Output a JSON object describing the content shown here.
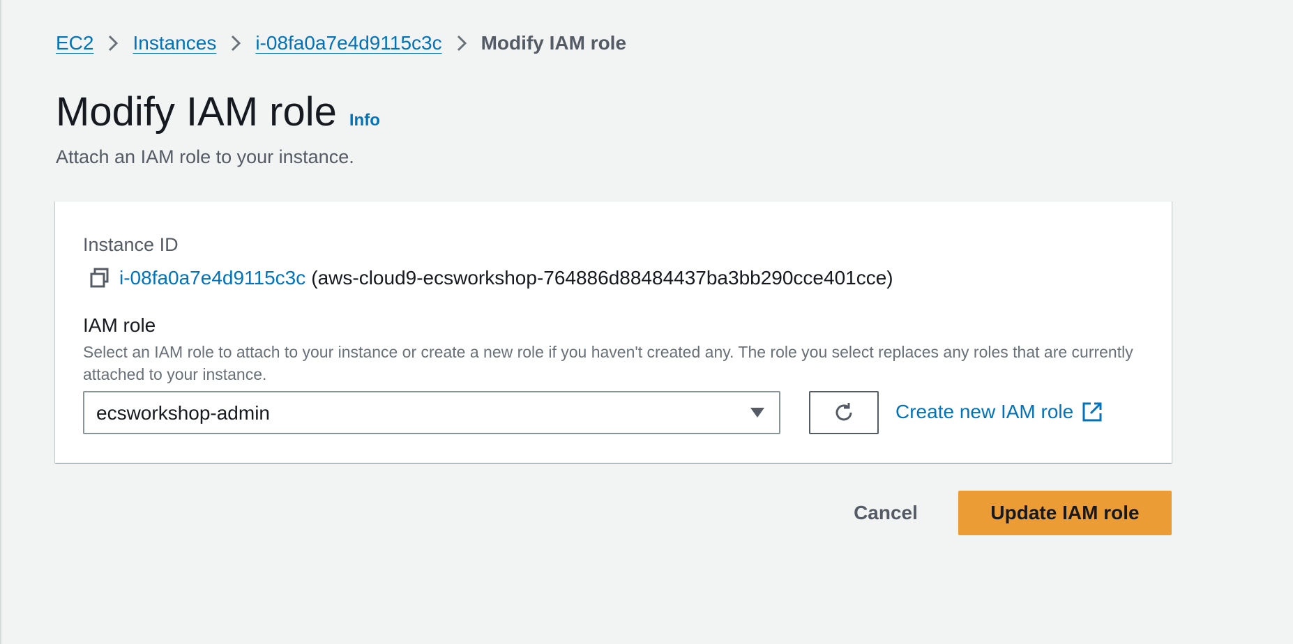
{
  "breadcrumb": {
    "items": [
      {
        "label": "EC2"
      },
      {
        "label": "Instances"
      },
      {
        "label": "i-08fa0a7e4d9115c3c"
      }
    ],
    "current": "Modify IAM role"
  },
  "header": {
    "title": "Modify IAM role",
    "info_label": "Info",
    "description": "Attach an IAM role to your instance."
  },
  "instance": {
    "label": "Instance ID",
    "id": "i-08fa0a7e4d9115c3c",
    "name": "(aws-cloud9-ecsworkshop-764886d88484437ba3bb290cce401cce)"
  },
  "iam_role": {
    "label": "IAM role",
    "description": "Select an IAM role to attach to your instance or create a new role if you haven't created any. The role you select replaces any roles that are currently attached to your instance.",
    "selected": "ecsworkshop-admin",
    "create_link": "Create new IAM role"
  },
  "actions": {
    "cancel": "Cancel",
    "submit": "Update IAM role"
  },
  "colors": {
    "background": "#f2f3f3",
    "link": "#0073bb",
    "primary": "#ec9c34",
    "text": "#16191f",
    "muted": "#545b64"
  },
  "icons": [
    "chevron-right-icon",
    "copy-icon",
    "caret-down-icon",
    "refresh-icon",
    "external-link-icon"
  ]
}
